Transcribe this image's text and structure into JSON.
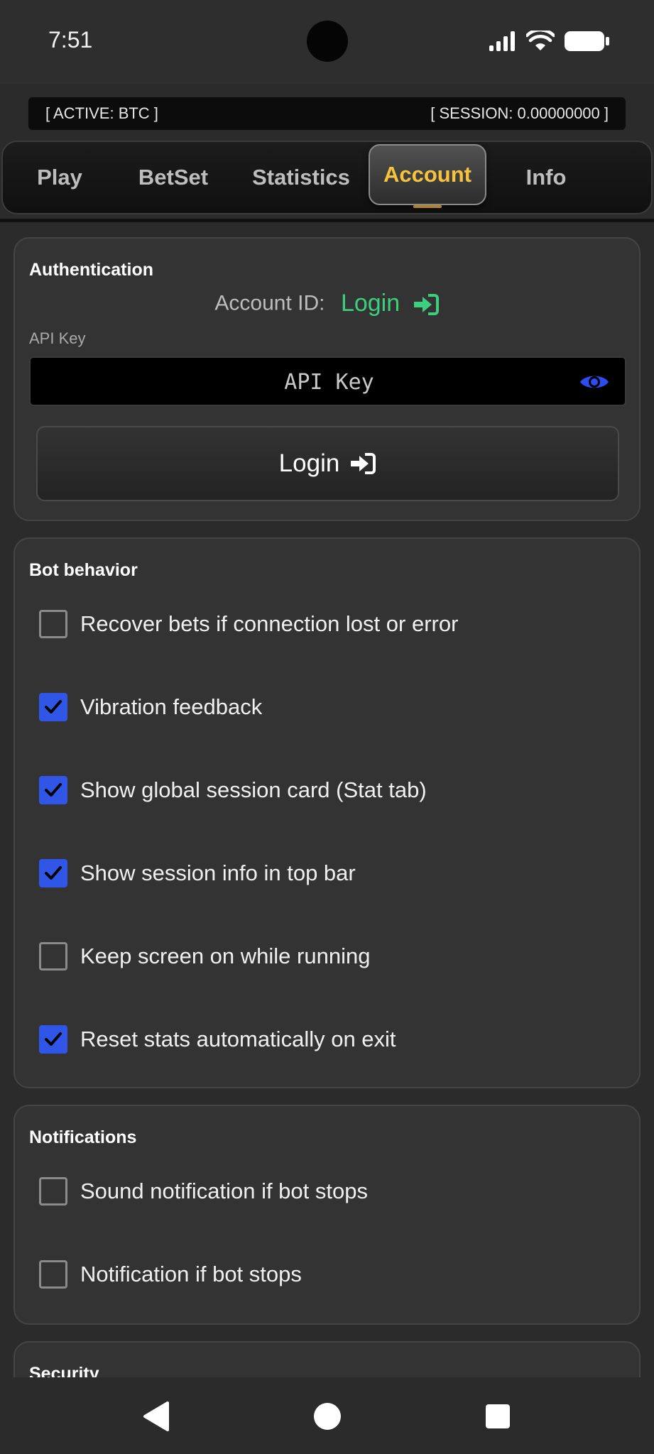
{
  "status_bar": {
    "time": "7:51"
  },
  "session_bar": {
    "active": "[ ACTIVE: BTC ]",
    "session": "[ SESSION: 0.00000000 ]"
  },
  "tabs": [
    {
      "label": "Play"
    },
    {
      "label": "BetSet"
    },
    {
      "label": "Statistics"
    },
    {
      "label": "Account",
      "active": true
    },
    {
      "label": "Info"
    }
  ],
  "authentication": {
    "title": "Authentication",
    "account_id_label": "Account ID:",
    "account_id_value": "Login",
    "api_key_label": "API Key",
    "api_key_placeholder": "API Key",
    "api_key_value": "",
    "login_button": "Login"
  },
  "bot_behavior": {
    "title": "Bot behavior",
    "options": [
      {
        "label": "Recover bets if connection lost or error",
        "checked": false
      },
      {
        "label": "Vibration feedback",
        "checked": true
      },
      {
        "label": "Show global session card (Stat tab)",
        "checked": true
      },
      {
        "label": "Show session info in top bar",
        "checked": true
      },
      {
        "label": "Keep screen on while running",
        "checked": false
      },
      {
        "label": "Reset stats automatically on exit",
        "checked": true
      }
    ]
  },
  "notifications": {
    "title": "Notifications",
    "options": [
      {
        "label": "Sound notification if bot stops",
        "checked": false
      },
      {
        "label": "Notification if bot stops",
        "checked": false
      }
    ]
  },
  "security": {
    "title": "Security"
  },
  "colors": {
    "accent_tab": "#f7c33d",
    "login_green": "#3ecf7e",
    "checkbox_blue": "#2f56e6",
    "eye_blue": "#2d4bf0"
  }
}
